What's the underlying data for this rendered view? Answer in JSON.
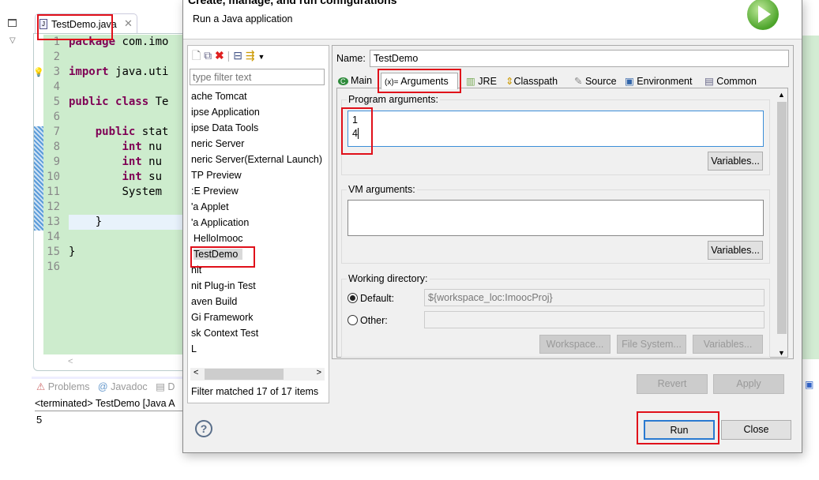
{
  "editor": {
    "tab_label": "TestDemo.java",
    "lines": [
      {
        "n": "1",
        "code": "package com.imo"
      },
      {
        "n": "2",
        "code": ""
      },
      {
        "n": "3",
        "code": "import java.uti"
      },
      {
        "n": "4",
        "code": ""
      },
      {
        "n": "5",
        "code": "public class Te"
      },
      {
        "n": "6",
        "code": ""
      },
      {
        "n": "7",
        "code": "    public stat"
      },
      {
        "n": "8",
        "code": "        int nu"
      },
      {
        "n": "9",
        "code": "        int nu"
      },
      {
        "n": "10",
        "code": "        int su"
      },
      {
        "n": "11",
        "code": "        System"
      },
      {
        "n": "12",
        "code": ""
      },
      {
        "n": "13",
        "code": "    }"
      },
      {
        "n": "14",
        "code": ""
      },
      {
        "n": "15",
        "code": "}"
      },
      {
        "n": "16",
        "code": ""
      }
    ]
  },
  "console": {
    "tabs": [
      "Problems",
      "Javadoc",
      "D"
    ],
    "status": "<terminated> TestDemo [Java A",
    "output": "5"
  },
  "dialog": {
    "title": "Create, manage, and run configurations",
    "subtitle": "Run a Java application",
    "filter_placeholder": "type filter text",
    "config_list": [
      "ache Tomcat",
      "ipse Application",
      "ipse Data Tools",
      "neric Server",
      "neric Server(External Launch)",
      "TP Preview",
      ":E Preview",
      "'a Applet",
      "'a Application",
      "HelloImooc",
      "TestDemo",
      "nit",
      "nit Plug-in Test",
      "aven Build",
      "Gi Framework",
      "sk Context Test",
      "L"
    ],
    "filter_status": "Filter matched 17 of 17 items",
    "name_label": "Name:",
    "name_value": "TestDemo",
    "tabs": [
      "Main",
      "Arguments",
      "JRE",
      "Classpath",
      "Source",
      "Environment",
      "Common"
    ],
    "program_args_label": "Program arguments:",
    "program_args": [
      "1",
      "4"
    ],
    "vm_args_label": "VM arguments:",
    "variables_label": "Variables...",
    "working_dir_label": "Working directory:",
    "default_label": "Default:",
    "default_value": "${workspace_loc:ImoocProj}",
    "other_label": "Other:",
    "workspace_btn": "Workspace...",
    "filesystem_btn": "File System...",
    "revert": "Revert",
    "apply": "Apply",
    "run": "Run",
    "close": "Close",
    "help_icon": "?"
  }
}
